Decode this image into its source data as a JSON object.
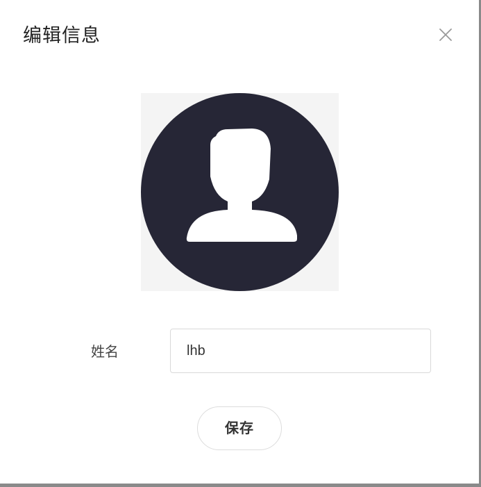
{
  "dialog": {
    "title": "编辑信息",
    "close_icon": "close-icon"
  },
  "avatar": {
    "icon": "user-avatar-icon",
    "background_color": "#262636",
    "figure_color": "#ffffff"
  },
  "form": {
    "name_label": "姓名",
    "name_value": "lhb"
  },
  "actions": {
    "save_label": "保存"
  }
}
